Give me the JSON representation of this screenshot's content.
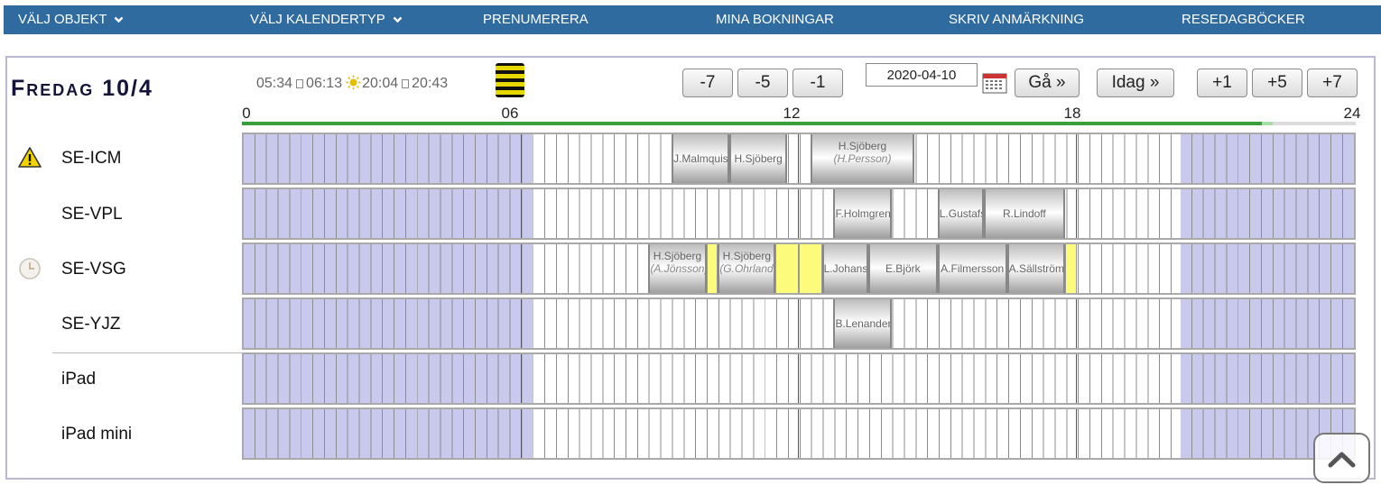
{
  "nav": {
    "items": [
      {
        "label": "VÄLJ OBJEKT",
        "dropdown": true
      },
      {
        "label": "VÄLJ KALENDERTYP",
        "dropdown": true
      },
      {
        "label": "PRENUMERERA",
        "dropdown": false
      },
      {
        "label": "MINA BOKNINGAR",
        "dropdown": false
      },
      {
        "label": "SKRIV ANMÄRKNING",
        "dropdown": false
      },
      {
        "label": "RESEDAGBÖCKER",
        "dropdown": false
      }
    ],
    "background": "#2f6b9e"
  },
  "header": {
    "day_title": "Fredag 10/4",
    "sun": {
      "dawn": "05:34",
      "sunrise": "06:13",
      "sunset": "20:04",
      "dusk": "20:43"
    },
    "weather_icon": "striped-yellow-black-icon",
    "buttons": {
      "minus7": "-7",
      "minus5": "-5",
      "minus1": "-1",
      "go": "Gå »",
      "today": "Idag »",
      "plus1": "+1",
      "plus5": "+5",
      "plus7": "+7"
    },
    "date_value": "2020-04-10",
    "calendar_icon": "calendar-icon"
  },
  "timeline": {
    "ticks": [
      "0",
      "06",
      "12",
      "18",
      "24"
    ],
    "now_hour": 21.95,
    "day_start_hour": 6,
    "day_end_hour": 20
  },
  "rows": [
    {
      "label": "SE-ICM",
      "icon": "warning-icon"
    },
    {
      "label": "SE-VPL",
      "icon": ""
    },
    {
      "label": "SE-VSG",
      "icon": "clock-icon"
    },
    {
      "label": "SE-YJZ",
      "icon": ""
    },
    {
      "label": "iPad",
      "icon": ""
    },
    {
      "label": "iPad mini",
      "icon": ""
    }
  ],
  "bookings": {
    "se_icm": [
      {
        "name": "J.Malmquist",
        "start": 9.25,
        "end": 10.5
      },
      {
        "name": "H.Sjöberg",
        "start": 10.5,
        "end": 11.75
      },
      {
        "name": "H.Sjöberg",
        "sub": "(H.Persson)",
        "start": 12.25,
        "end": 14.5
      }
    ],
    "se_vpl": [
      {
        "name": "F.Holmgren",
        "start": 12.75,
        "end": 14.0
      },
      {
        "name": "L.Gustafsson",
        "start": 15.0,
        "end": 16.0
      },
      {
        "name": "R.Lindoff",
        "start": 16.0,
        "end": 17.75
      }
    ],
    "se_vsg": [
      {
        "name": "H.Sjöberg",
        "sub": "(A.Jönsson)",
        "start": 8.75,
        "end": 10.0
      },
      {
        "name": "H.Sjöberg",
        "sub": "(G.Ohrlander)",
        "start": 10.25,
        "end": 11.5
      },
      {
        "name": "L.Johansson",
        "start": 12.5,
        "end": 13.5
      },
      {
        "name": "E.Björk",
        "start": 13.5,
        "end": 15.0
      },
      {
        "name": "A.Filmersson",
        "start": 15.0,
        "end": 16.5
      },
      {
        "name": "A.Sällström",
        "start": 16.5,
        "end": 17.75
      }
    ],
    "se_vsg_yellow": [
      {
        "start": 10.0,
        "end": 10.25
      },
      {
        "start": 11.5,
        "end": 12.0
      },
      {
        "start": 12.0,
        "end": 12.5
      },
      {
        "start": 17.75,
        "end": 18.0
      }
    ],
    "se_yjz": [
      {
        "name": "B.Lenander",
        "start": 12.75,
        "end": 14.0
      }
    ]
  },
  "scroll_top_icon": "chevron-up-icon"
}
